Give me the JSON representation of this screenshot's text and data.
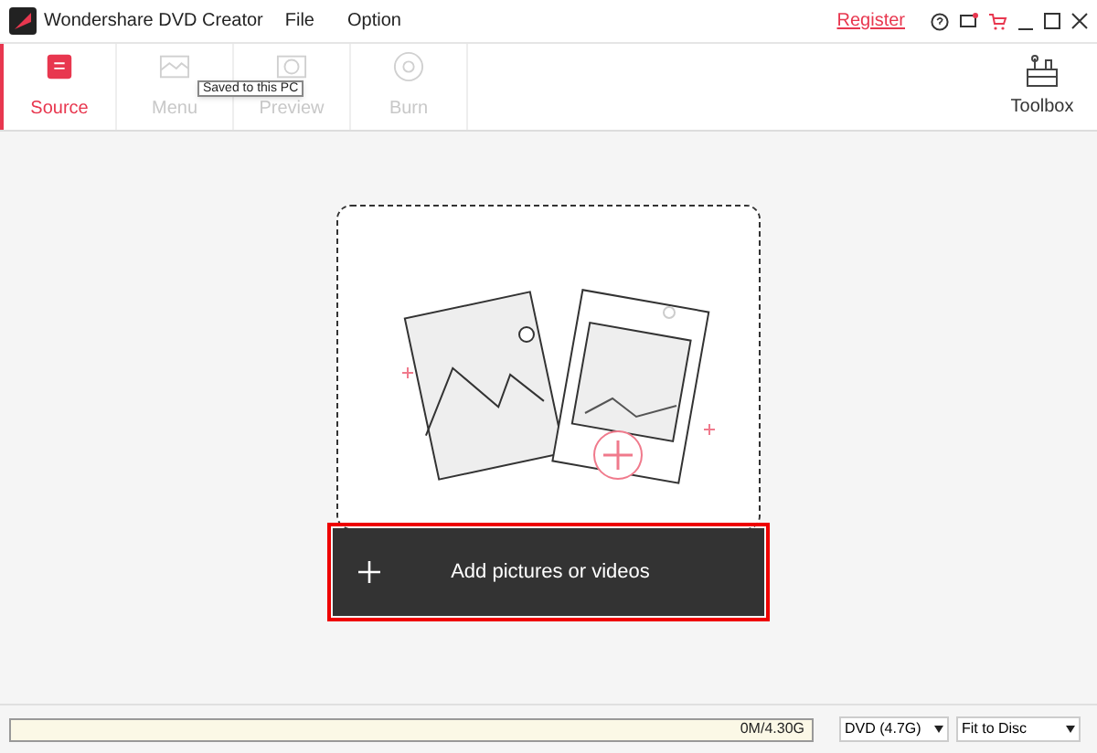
{
  "window": {
    "title": "Wondershare DVD Creator",
    "menu": [
      "File",
      "Option"
    ],
    "register": "Register"
  },
  "steps": [
    {
      "label": "Source",
      "selected": true,
      "kind": "source"
    },
    {
      "label": "Menu",
      "selected": false,
      "kind": "menu"
    },
    {
      "label": "Preview",
      "selected": false,
      "kind": "preview"
    },
    {
      "label": "Burn",
      "selected": false,
      "kind": "burn"
    }
  ],
  "tooltip": "Saved to this PC",
  "toolbox": "Toolbox",
  "drop_area": {
    "button": "Add pictures or videos",
    "highlighted": true
  },
  "status_bar": {
    "capacity": "0M/4.30G",
    "disc": "DVD (4.7G)",
    "mode": "Fit to Disc"
  }
}
